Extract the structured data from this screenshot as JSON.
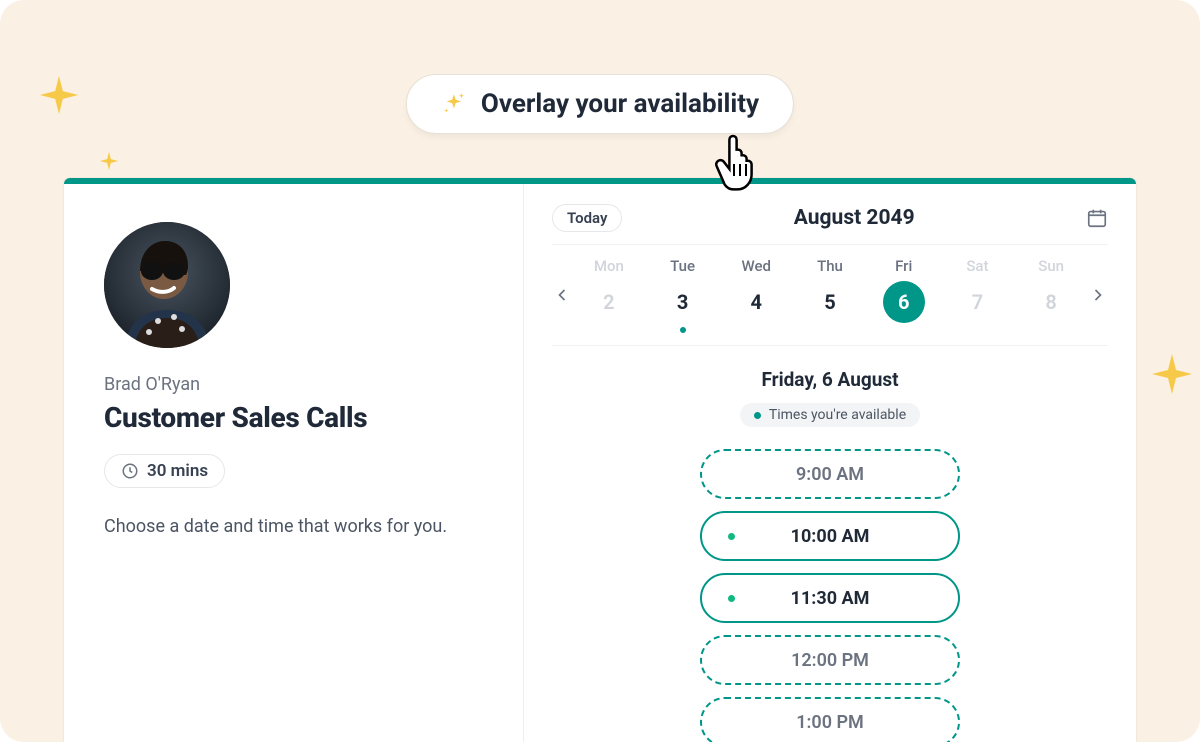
{
  "overlay": {
    "label": "Overlay your availability"
  },
  "left": {
    "host_name": "Brad O'Ryan",
    "title": "Customer Sales Calls",
    "duration": "30 mins",
    "description": "Choose a date and time that works for you."
  },
  "calendar": {
    "today_label": "Today",
    "month_label": "August 2049",
    "weekdays": [
      {
        "short": "Mon",
        "num": "2",
        "disabled": true
      },
      {
        "short": "Tue",
        "num": "3",
        "disabled": false,
        "has_dot": true
      },
      {
        "short": "Wed",
        "num": "4",
        "disabled": false
      },
      {
        "short": "Thu",
        "num": "5",
        "disabled": false
      },
      {
        "short": "Fri",
        "num": "6",
        "disabled": false,
        "selected": true
      },
      {
        "short": "Sat",
        "num": "7",
        "disabled": true
      },
      {
        "short": "Sun",
        "num": "8",
        "disabled": true
      }
    ],
    "selected_date_label": "Friday, 6 August",
    "availability_chip": "Times you're available",
    "slots": [
      {
        "time": "9:00 AM",
        "available": false
      },
      {
        "time": "10:00 AM",
        "available": true
      },
      {
        "time": "11:30 AM",
        "available": true
      },
      {
        "time": "12:00 PM",
        "available": false
      },
      {
        "time": "1:00 PM",
        "available": false
      }
    ]
  },
  "colors": {
    "accent": "#009688",
    "gold": "#F7C948"
  }
}
